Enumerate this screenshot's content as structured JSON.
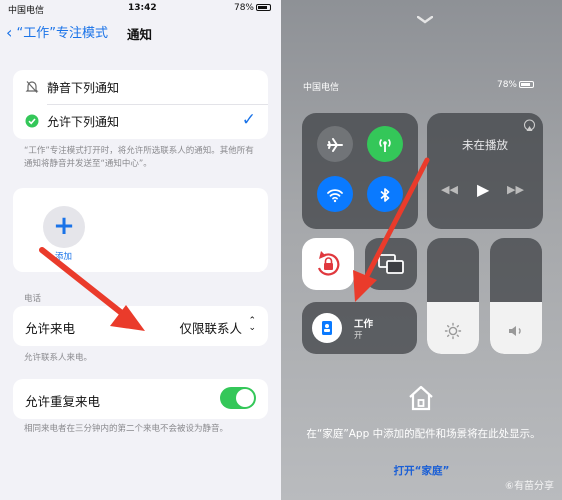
{
  "left": {
    "status": {
      "carrier": "中国电信",
      "time": "13:42",
      "battery": "78%"
    },
    "nav": {
      "back_label": "“工作”专注模式",
      "title": "通知"
    },
    "options": [
      {
        "label": "静音下列通知",
        "selected": false
      },
      {
        "label": "允许下列通知",
        "selected": true
      }
    ],
    "options_footnote": "“工作”专注模式打开时，将允许所选联系人的通知。其他所有通知将静音并发送至“通知中心”。",
    "add": {
      "symbol": "+",
      "label": "添加"
    },
    "calls_section": "电话",
    "allow_calls": {
      "label": "允许来电",
      "value": "仅限联系人"
    },
    "allow_calls_footnote": "允许联系人来电。",
    "repeated": {
      "label": "允许重复来电",
      "enabled": true
    },
    "repeated_footnote": "相同来电者在三分钟内的第二个来电不会被设为静音。",
    "colors": {
      "accent": "#1a73e8",
      "toggle_on": "#34c759",
      "arrow": "#ea3b2b"
    }
  },
  "right": {
    "status": {
      "carrier": "中国电信",
      "battery": "78%"
    },
    "connectivity": {
      "airplane": {
        "icon": "airplane-icon",
        "on": false
      },
      "cellular": {
        "icon": "cellular-icon",
        "on": true
      },
      "wifi": {
        "icon": "wifi-icon",
        "on": true
      },
      "bluetooth": {
        "icon": "bluetooth-icon",
        "on": true
      }
    },
    "media": {
      "title": "未在播放"
    },
    "focus": {
      "name": "工作",
      "state": "开"
    },
    "brightness_level": 0.45,
    "volume_level": 0.45,
    "home": {
      "message": "在“家庭”App 中添加的配件和场景将在此处显示。",
      "link": "打开“家庭”"
    },
    "watermark": "⑥有苗分享",
    "colors": {
      "cellular": "#34c759",
      "blue": "#0a7aff",
      "tile": "#3c3e42"
    }
  }
}
